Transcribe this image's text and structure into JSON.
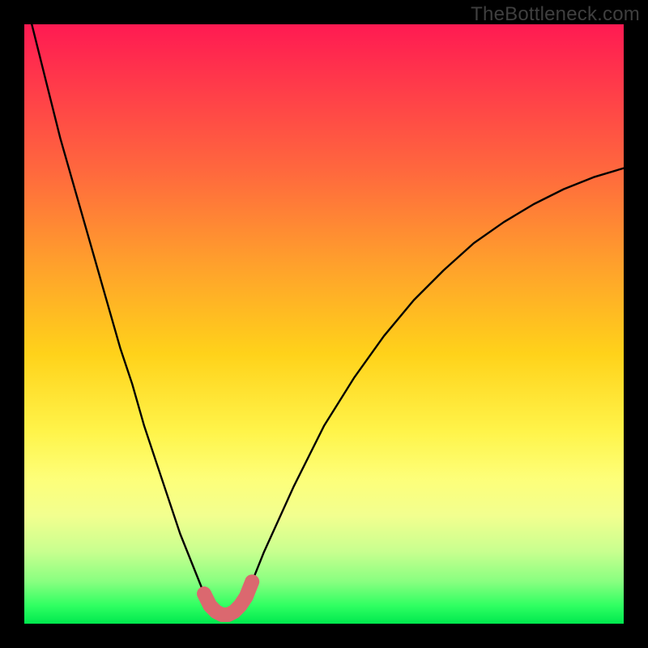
{
  "watermark": "TheBottleneck.com",
  "chart_data": {
    "type": "line",
    "title": "",
    "xlabel": "",
    "ylabel": "",
    "xlim": [
      0,
      100
    ],
    "ylim": [
      0,
      100
    ],
    "x": [
      0,
      2,
      4,
      6,
      8,
      10,
      12,
      14,
      16,
      18,
      20,
      22,
      24,
      26,
      28,
      30,
      31,
      32,
      33,
      34,
      35,
      36,
      37,
      38,
      40,
      45,
      50,
      55,
      60,
      65,
      70,
      75,
      80,
      85,
      90,
      95,
      100
    ],
    "values": [
      105,
      97,
      89,
      81,
      74,
      67,
      60,
      53,
      46,
      40,
      33,
      27,
      21,
      15,
      10,
      5,
      3,
      2,
      1.5,
      1.5,
      2,
      3,
      4.5,
      7,
      12,
      23,
      33,
      41,
      48,
      54,
      59,
      63.5,
      67,
      70,
      72.5,
      74.5,
      76
    ],
    "highlight_region": {
      "x_range": [
        29,
        38
      ],
      "color": "#db686f"
    },
    "colors": {
      "curve": "#000000",
      "highlight": "#db686f",
      "gradient_top": "#ff1a52",
      "gradient_bottom": "#00e84e"
    }
  }
}
